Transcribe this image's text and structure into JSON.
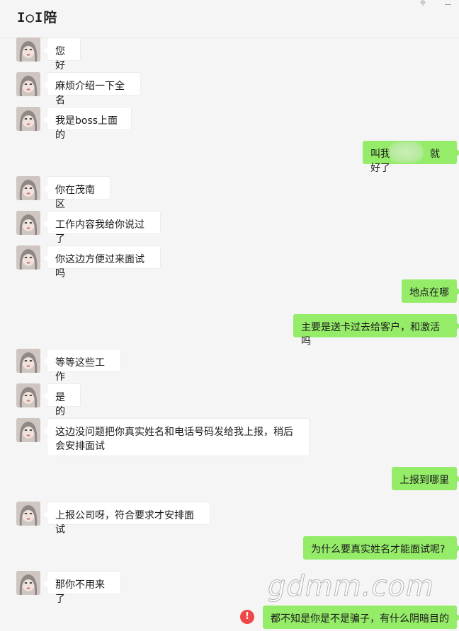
{
  "header": {
    "title": "I○I陪",
    "pin_icon": "pin-icon",
    "minimize_icon": "minimize-icon"
  },
  "colors": {
    "background": "#f5f5f5",
    "incoming_bubble": "#ffffff",
    "outgoing_bubble": "#95ec69",
    "error": "#f04848"
  },
  "messages": [
    {
      "side": "in",
      "text": "您好"
    },
    {
      "side": "in",
      "text": "麻烦介绍一下全名"
    },
    {
      "side": "in",
      "text": "我是boss上面的"
    },
    {
      "side": "out",
      "text": "叫我　　　　就好了",
      "redacted": true
    },
    {
      "side": "in",
      "text": "你在茂南区"
    },
    {
      "side": "in",
      "text": "工作内容我给你说过了"
    },
    {
      "side": "in",
      "text": "你这边方便过来面试吗"
    },
    {
      "side": "out",
      "text": "地点在哪"
    },
    {
      "side": "out",
      "text": "主要是送卡过去给客户，和激活吗"
    },
    {
      "side": "in",
      "text": "等等这些工作"
    },
    {
      "side": "in",
      "text": "是的"
    },
    {
      "side": "in",
      "text": "这边没问题把你真实姓名和电话号码发给我上报，稍后会安排面试"
    },
    {
      "side": "out",
      "text": "上报到哪里"
    },
    {
      "side": "in",
      "text": "上报公司呀，符合要求才安排面试"
    },
    {
      "side": "out",
      "text": "为什么要真实姓名才能面试呢?"
    },
    {
      "side": "in",
      "text": "那你不用来了"
    },
    {
      "side": "out",
      "text": "都不知是你是不是骗子，有什么阴暗目的",
      "failed": true
    }
  ],
  "error_icon_text": "!",
  "watermark": "gdmm.com"
}
